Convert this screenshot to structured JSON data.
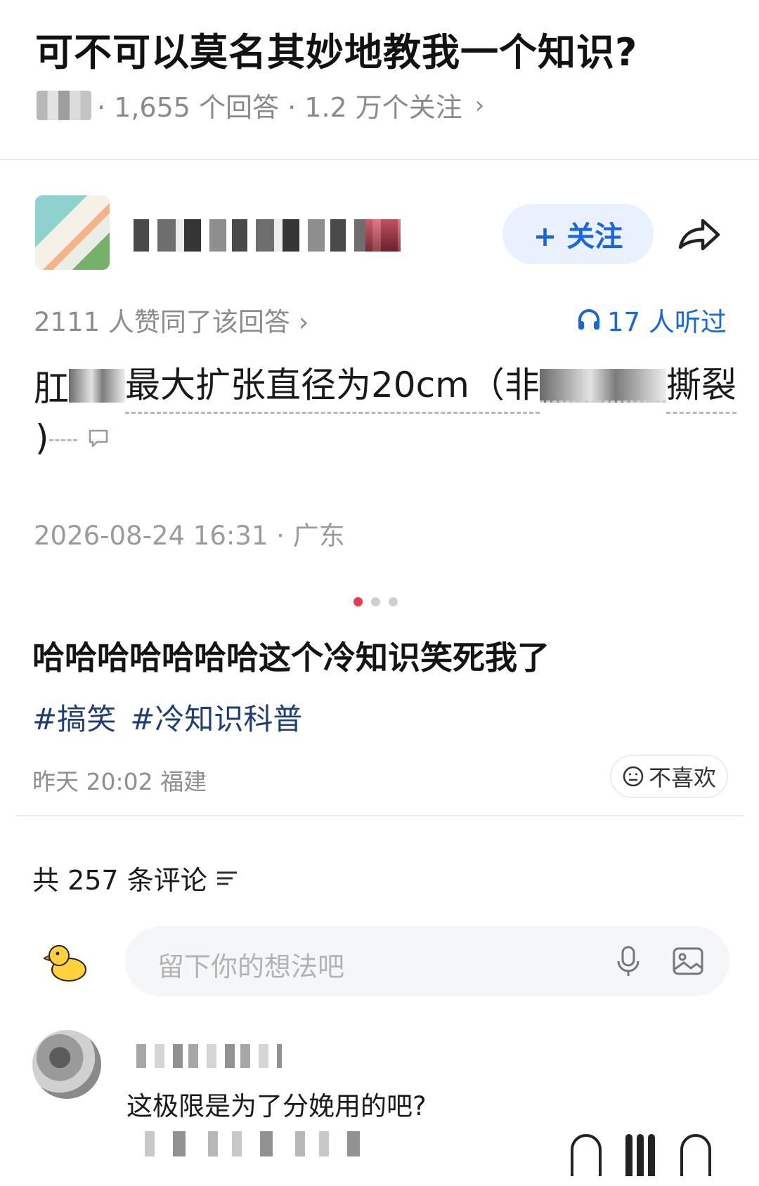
{
  "question": {
    "title": "可不可以莫名其妙地教我一个知识?",
    "answers_count": "· 1,655 个回答 · 1.2 万个关注",
    "chevron": "›"
  },
  "author": {
    "follow_label": "+ 关注",
    "share_icon": "share-arrow-icon"
  },
  "answer": {
    "agree_text": "2111 人赞同了该回答 ›",
    "listen_count": "17 人听过",
    "text_part1": "肛",
    "text_part2": "最大扩张直径为20cm（非",
    "text_part3": "撕裂",
    "text_line2": ")",
    "timestamp": "2026-08-24 16:31 · 广东"
  },
  "post": {
    "title": "哈哈哈哈哈哈哈这个冷知识笑死我了",
    "tags": [
      "#搞笑",
      "#冷知识科普"
    ],
    "time": "昨天 20:02 福建",
    "dislike_label": "不喜欢"
  },
  "comments": {
    "count_label": "共 257 条评论",
    "input_placeholder": "留下你的想法吧",
    "items": [
      {
        "text": "这极限是为了分娩用的吧?"
      }
    ]
  },
  "colors": {
    "accent_blue": "#1966e0",
    "follow_bg": "#e8f1fd",
    "tag_color": "#1f3e73",
    "dot_active": "#e8394f"
  }
}
